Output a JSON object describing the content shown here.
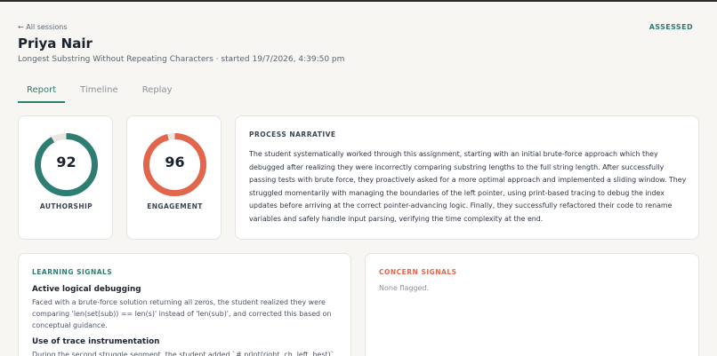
{
  "header": {
    "back_label": "← All sessions",
    "status_badge": "ASSESSED",
    "student_name": "Priya Nair",
    "session_meta": "Longest Substring Without Repeating Characters · started 19/7/2026, 4:39:50 pm"
  },
  "tabs": [
    {
      "label": "Report",
      "active": true
    },
    {
      "label": "Timeline",
      "active": false
    },
    {
      "label": "Replay",
      "active": false
    }
  ],
  "scores": [
    {
      "label": "AUTHORSHIP",
      "value": 92,
      "color": "#2d7d73"
    },
    {
      "label": "ENGAGEMENT",
      "value": 96,
      "color": "#e2664c"
    }
  ],
  "ring_track_color": "#e9e7e3",
  "narrative": {
    "title": "PROCESS NARRATIVE",
    "text": "The student systematically worked through this assignment, starting with an initial brute-force approach which they debugged after realizing they were incorrectly comparing substring lengths to the full string length. After successfully passing tests with brute force, they proactively asked for a more optimal approach and implemented a sliding window. They struggled momentarily with managing the boundaries of the left pointer, using print-based tracing to debug the index updates before arriving at the correct pointer-advancing logic. Finally, they successfully refactored their code to rename variables and safely handle input parsing, verifying the time complexity at the end."
  },
  "learning_signals": {
    "title": "LEARNING SIGNALS",
    "items": [
      {
        "title": "Active logical debugging",
        "description": "Faced with a brute-force solution returning all zeros, the student realized they were comparing 'len(set(sub)) == len(s)' instead of 'len(sub)', and corrected this based on conceptual guidance."
      },
      {
        "title": "Use of trace instrumentation",
        "description": "During the second struggle segment, the student added `# print(right, ch, left, best)` to"
      }
    ]
  },
  "concern_signals": {
    "title": "CONCERN SIGNALS",
    "empty_text": "None flagged."
  },
  "colors": {
    "accent": "#2d7d73",
    "concern": "#e2664c"
  }
}
